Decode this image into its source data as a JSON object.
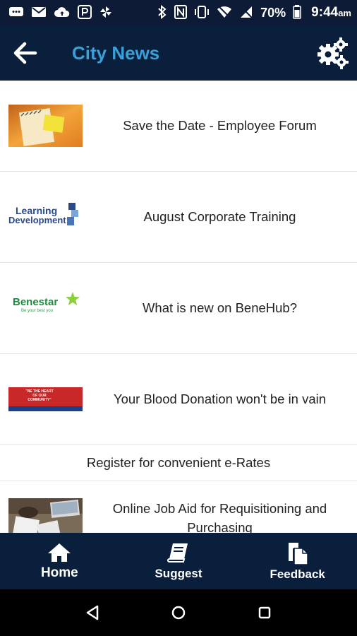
{
  "status_bar": {
    "battery": "70%",
    "time": "9:44",
    "ampm": "am"
  },
  "app_bar": {
    "title": "City News"
  },
  "news": [
    {
      "title": "Save the Date - Employee Forum"
    },
    {
      "title": "August Corporate Training",
      "thumb_text": [
        "Learning",
        "Development"
      ]
    },
    {
      "title": "What is new on BeneHub?",
      "thumb_text": [
        "Benestar",
        "Be your best you"
      ]
    },
    {
      "title": "Your Blood Donation won't be in vain",
      "thumb_text": [
        "\"BE THE HEART OF OUR COMMUNITY\""
      ]
    },
    {
      "title": "Register for convenient e-Rates"
    },
    {
      "title": "Online Job Aid for Requisitioning and Purchasing"
    }
  ],
  "bottom_nav": {
    "home": "Home",
    "suggest": "Suggest",
    "feedback": "Feedback"
  },
  "colors": {
    "header_bg": "#0a1f3c",
    "title_accent": "#3aa0d8"
  }
}
